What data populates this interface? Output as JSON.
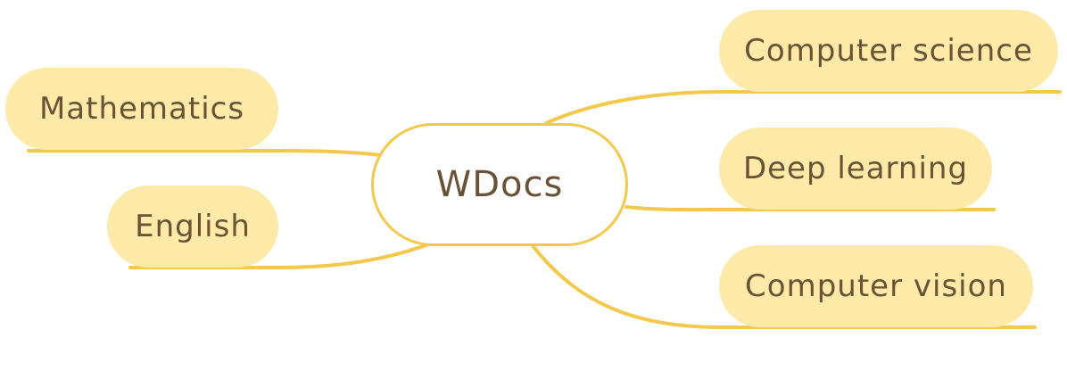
{
  "root": {
    "label": "WDocs"
  },
  "left_branches": [
    {
      "label": "Mathematics"
    },
    {
      "label": "English"
    }
  ],
  "right_branches": [
    {
      "label": "Computer science"
    },
    {
      "label": "Deep learning"
    },
    {
      "label": "Computer vision"
    }
  ],
  "colors": {
    "connector": "#f2c94c",
    "branch_fill": "#fde9a8",
    "root_border": "#f2c94c",
    "text": "#6a5236"
  }
}
